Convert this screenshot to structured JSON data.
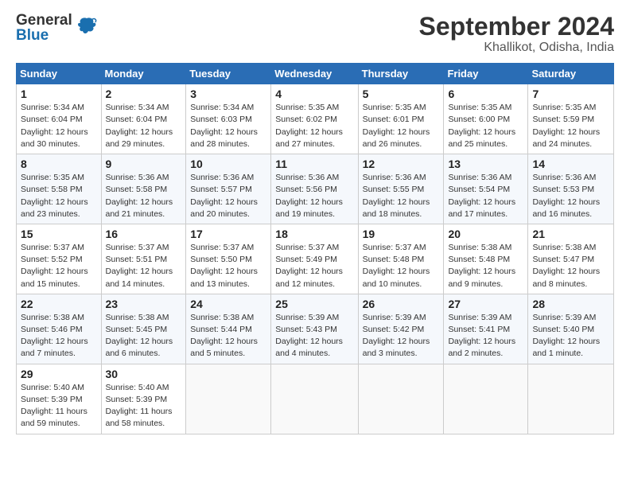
{
  "logo": {
    "line1": "General",
    "line2": "Blue"
  },
  "title": "September 2024",
  "subtitle": "Khallikot, Odisha, India",
  "days_of_week": [
    "Sunday",
    "Monday",
    "Tuesday",
    "Wednesday",
    "Thursday",
    "Friday",
    "Saturday"
  ],
  "weeks": [
    [
      {
        "day": "1",
        "info": "Sunrise: 5:34 AM\nSunset: 6:04 PM\nDaylight: 12 hours\nand 30 minutes."
      },
      {
        "day": "2",
        "info": "Sunrise: 5:34 AM\nSunset: 6:04 PM\nDaylight: 12 hours\nand 29 minutes."
      },
      {
        "day": "3",
        "info": "Sunrise: 5:34 AM\nSunset: 6:03 PM\nDaylight: 12 hours\nand 28 minutes."
      },
      {
        "day": "4",
        "info": "Sunrise: 5:35 AM\nSunset: 6:02 PM\nDaylight: 12 hours\nand 27 minutes."
      },
      {
        "day": "5",
        "info": "Sunrise: 5:35 AM\nSunset: 6:01 PM\nDaylight: 12 hours\nand 26 minutes."
      },
      {
        "day": "6",
        "info": "Sunrise: 5:35 AM\nSunset: 6:00 PM\nDaylight: 12 hours\nand 25 minutes."
      },
      {
        "day": "7",
        "info": "Sunrise: 5:35 AM\nSunset: 5:59 PM\nDaylight: 12 hours\nand 24 minutes."
      }
    ],
    [
      {
        "day": "8",
        "info": "Sunrise: 5:35 AM\nSunset: 5:58 PM\nDaylight: 12 hours\nand 23 minutes."
      },
      {
        "day": "9",
        "info": "Sunrise: 5:36 AM\nSunset: 5:58 PM\nDaylight: 12 hours\nand 21 minutes."
      },
      {
        "day": "10",
        "info": "Sunrise: 5:36 AM\nSunset: 5:57 PM\nDaylight: 12 hours\nand 20 minutes."
      },
      {
        "day": "11",
        "info": "Sunrise: 5:36 AM\nSunset: 5:56 PM\nDaylight: 12 hours\nand 19 minutes."
      },
      {
        "day": "12",
        "info": "Sunrise: 5:36 AM\nSunset: 5:55 PM\nDaylight: 12 hours\nand 18 minutes."
      },
      {
        "day": "13",
        "info": "Sunrise: 5:36 AM\nSunset: 5:54 PM\nDaylight: 12 hours\nand 17 minutes."
      },
      {
        "day": "14",
        "info": "Sunrise: 5:36 AM\nSunset: 5:53 PM\nDaylight: 12 hours\nand 16 minutes."
      }
    ],
    [
      {
        "day": "15",
        "info": "Sunrise: 5:37 AM\nSunset: 5:52 PM\nDaylight: 12 hours\nand 15 minutes."
      },
      {
        "day": "16",
        "info": "Sunrise: 5:37 AM\nSunset: 5:51 PM\nDaylight: 12 hours\nand 14 minutes."
      },
      {
        "day": "17",
        "info": "Sunrise: 5:37 AM\nSunset: 5:50 PM\nDaylight: 12 hours\nand 13 minutes."
      },
      {
        "day": "18",
        "info": "Sunrise: 5:37 AM\nSunset: 5:49 PM\nDaylight: 12 hours\nand 12 minutes."
      },
      {
        "day": "19",
        "info": "Sunrise: 5:37 AM\nSunset: 5:48 PM\nDaylight: 12 hours\nand 10 minutes."
      },
      {
        "day": "20",
        "info": "Sunrise: 5:38 AM\nSunset: 5:48 PM\nDaylight: 12 hours\nand 9 minutes."
      },
      {
        "day": "21",
        "info": "Sunrise: 5:38 AM\nSunset: 5:47 PM\nDaylight: 12 hours\nand 8 minutes."
      }
    ],
    [
      {
        "day": "22",
        "info": "Sunrise: 5:38 AM\nSunset: 5:46 PM\nDaylight: 12 hours\nand 7 minutes."
      },
      {
        "day": "23",
        "info": "Sunrise: 5:38 AM\nSunset: 5:45 PM\nDaylight: 12 hours\nand 6 minutes."
      },
      {
        "day": "24",
        "info": "Sunrise: 5:38 AM\nSunset: 5:44 PM\nDaylight: 12 hours\nand 5 minutes."
      },
      {
        "day": "25",
        "info": "Sunrise: 5:39 AM\nSunset: 5:43 PM\nDaylight: 12 hours\nand 4 minutes."
      },
      {
        "day": "26",
        "info": "Sunrise: 5:39 AM\nSunset: 5:42 PM\nDaylight: 12 hours\nand 3 minutes."
      },
      {
        "day": "27",
        "info": "Sunrise: 5:39 AM\nSunset: 5:41 PM\nDaylight: 12 hours\nand 2 minutes."
      },
      {
        "day": "28",
        "info": "Sunrise: 5:39 AM\nSunset: 5:40 PM\nDaylight: 12 hours\nand 1 minute."
      }
    ],
    [
      {
        "day": "29",
        "info": "Sunrise: 5:40 AM\nSunset: 5:39 PM\nDaylight: 11 hours\nand 59 minutes."
      },
      {
        "day": "30",
        "info": "Sunrise: 5:40 AM\nSunset: 5:39 PM\nDaylight: 11 hours\nand 58 minutes."
      },
      {
        "day": "",
        "info": ""
      },
      {
        "day": "",
        "info": ""
      },
      {
        "day": "",
        "info": ""
      },
      {
        "day": "",
        "info": ""
      },
      {
        "day": "",
        "info": ""
      }
    ]
  ]
}
